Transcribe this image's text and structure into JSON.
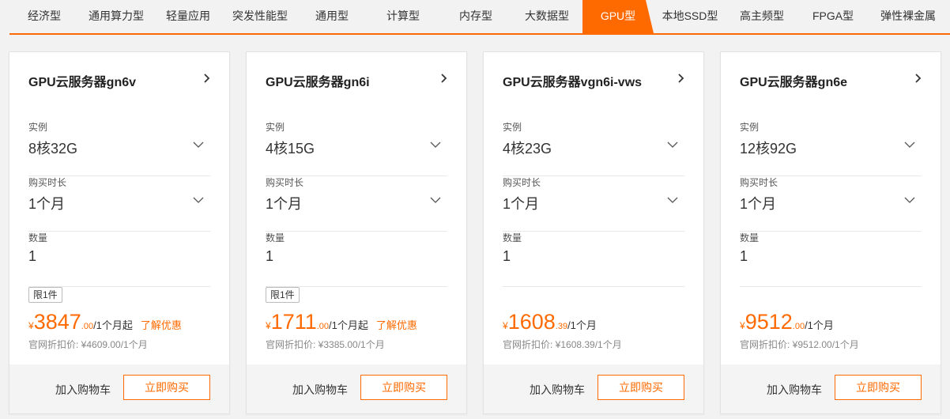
{
  "tabs": [
    {
      "label": "经济型",
      "active": false
    },
    {
      "label": "通用算力型",
      "active": false
    },
    {
      "label": "轻量应用",
      "active": false
    },
    {
      "label": "突发性能型",
      "active": false
    },
    {
      "label": "通用型",
      "active": false
    },
    {
      "label": "计算型",
      "active": false
    },
    {
      "label": "内存型",
      "active": false
    },
    {
      "label": "大数据型",
      "active": false
    },
    {
      "label": "GPU型",
      "active": true
    },
    {
      "label": "本地SSD型",
      "active": false
    },
    {
      "label": "高主频型",
      "active": false
    },
    {
      "label": "FPGA型",
      "active": false
    },
    {
      "label": "弹性裸金属",
      "active": false
    }
  ],
  "colors": {
    "accent": "#ff6a00",
    "card_bg": "#ffffff",
    "page_bg": "#f2f2f2",
    "footer_bg": "#f4f4f4"
  },
  "labels": {
    "instance": "实例",
    "duration": "购买时长",
    "quantity": "数量",
    "add_to_cart": "加入购物车",
    "buy_now": "立即购买",
    "yen": "¥"
  },
  "cards": [
    {
      "title": "GPU云服务器gn6v",
      "instance": "8核32G",
      "duration": "1个月",
      "quantity": "1",
      "limit_badge": "限1件",
      "price_int": "3847",
      "price_dec": ".00",
      "price_unit": "/1个月起",
      "promo": "了解优惠",
      "orig_price": "官网折扣价: ¥4609.00/1个月"
    },
    {
      "title": "GPU云服务器gn6i",
      "instance": "4核15G",
      "duration": "1个月",
      "quantity": "1",
      "limit_badge": "限1件",
      "price_int": "1711",
      "price_dec": ".00",
      "price_unit": "/1个月起",
      "promo": "了解优惠",
      "orig_price": "官网折扣价: ¥3385.00/1个月"
    },
    {
      "title": "GPU云服务器vgn6i-vws",
      "instance": "4核23G",
      "duration": "1个月",
      "quantity": "1",
      "limit_badge": "",
      "price_int": "1608",
      "price_dec": ".39",
      "price_unit": "/1个月",
      "promo": "",
      "orig_price": "官网折扣价: ¥1608.39/1个月"
    },
    {
      "title": "GPU云服务器gn6e",
      "instance": "12核92G",
      "duration": "1个月",
      "quantity": "1",
      "limit_badge": "",
      "price_int": "9512",
      "price_dec": ".00",
      "price_unit": "/1个月",
      "promo": "",
      "orig_price": "官网折扣价: ¥9512.00/1个月"
    }
  ]
}
